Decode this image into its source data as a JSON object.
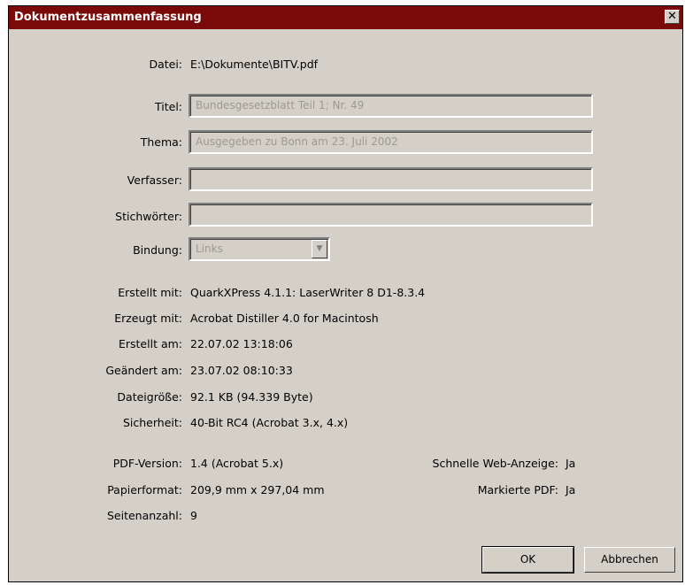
{
  "window": {
    "title": "Dokumentzusammenfassung",
    "close_glyph": "✕"
  },
  "file": {
    "label": "Datei:",
    "value": "E:\\Dokumente\\BITV.pdf"
  },
  "fields": {
    "title": {
      "label": "Titel:",
      "value": "Bundesgesetzblatt Teil 1; Nr. 49"
    },
    "subject": {
      "label": "Thema:",
      "value": "Ausgegeben zu Bonn am 23. Juli 2002"
    },
    "author": {
      "label": "Verfasser:",
      "value": ""
    },
    "keywords": {
      "label": "Stichwörter:",
      "value": ""
    },
    "binding": {
      "label": "Bindung:",
      "value": "Links"
    }
  },
  "info": {
    "created_with": {
      "label": "Erstellt mit:",
      "value": "QuarkXPress 4.1.1: LaserWriter 8 D1-8.3.4"
    },
    "produced_with": {
      "label": "Erzeugt mit:",
      "value": "Acrobat Distiller 4.0 for Macintosh"
    },
    "created_on": {
      "label": "Erstellt am:",
      "value": "22.07.02 13:18:06"
    },
    "modified_on": {
      "label": "Geändert am:",
      "value": "23.07.02 08:10:33"
    },
    "file_size": {
      "label": "Dateigröße:",
      "value": "92.1 KB (94.339 Byte)"
    },
    "security": {
      "label": "Sicherheit:",
      "value": "40-Bit RC4 (Acrobat 3.x, 4.x)"
    }
  },
  "pdf": {
    "version": {
      "label": "PDF-Version:",
      "value": "1.4 (Acrobat 5.x)"
    },
    "paper": {
      "label": "Papierformat:",
      "value": "209,9 mm x 297,04 mm"
    },
    "pages": {
      "label": "Seitenanzahl:",
      "value": "9"
    },
    "fast_web": {
      "label": "Schnelle Web-Anzeige:",
      "value": "Ja"
    },
    "tagged": {
      "label": "Markierte PDF:",
      "value": "Ja"
    }
  },
  "buttons": {
    "ok": "OK",
    "cancel": "Abbrechen"
  },
  "colors": {
    "titlebar": "#7a0a0a",
    "dialog_bg": "#d4d0c8",
    "disabled_text": "#9c9a95"
  }
}
